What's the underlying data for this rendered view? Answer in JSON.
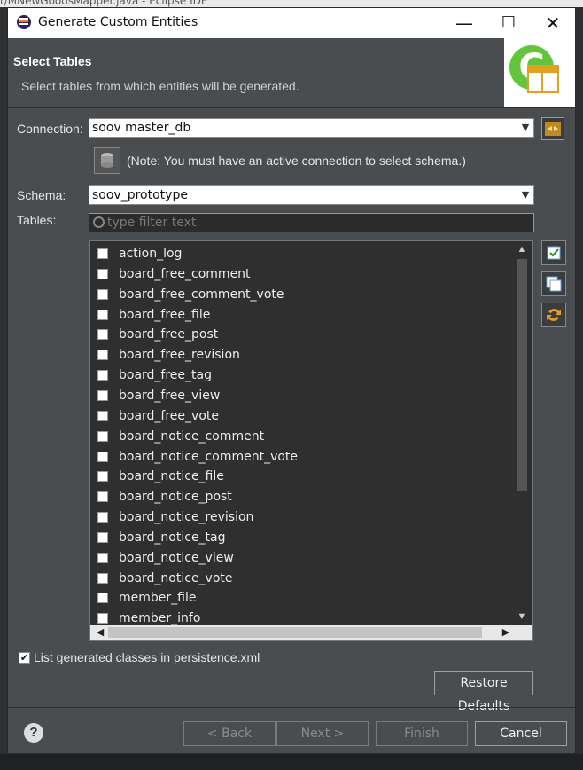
{
  "background_window": {
    "title": "t/MNewGoodsMapper.java - Eclipse IDE"
  },
  "window": {
    "title": "Generate Custom Entities",
    "minimize": "—",
    "maximize": "☐",
    "close": "✕"
  },
  "header": {
    "title": "Select Tables",
    "description": "Select tables from which entities will be generated."
  },
  "connection": {
    "label": "Connection:",
    "value": "soov master_db",
    "note": "(Note: You must have an active connection to select schema.)"
  },
  "schema": {
    "label": "Schema:",
    "value": "soov_prototype"
  },
  "tables": {
    "label": "Tables:",
    "filter_placeholder": "type filter text",
    "items": [
      "action_log",
      "board_free_comment",
      "board_free_comment_vote",
      "board_free_file",
      "board_free_post",
      "board_free_revision",
      "board_free_tag",
      "board_free_view",
      "board_free_vote",
      "board_notice_comment",
      "board_notice_comment_vote",
      "board_notice_file",
      "board_notice_post",
      "board_notice_revision",
      "board_notice_tag",
      "board_notice_view",
      "board_notice_vote",
      "member_file",
      "member_info"
    ]
  },
  "options": {
    "list_in_persistence_label": "List generated classes in persistence.xml",
    "list_in_persistence_checked": true
  },
  "buttons": {
    "restore_defaults": "Restore Defaults",
    "back": "< Back",
    "next": "Next >",
    "finish": "Finish",
    "cancel": "Cancel",
    "help": "?"
  }
}
